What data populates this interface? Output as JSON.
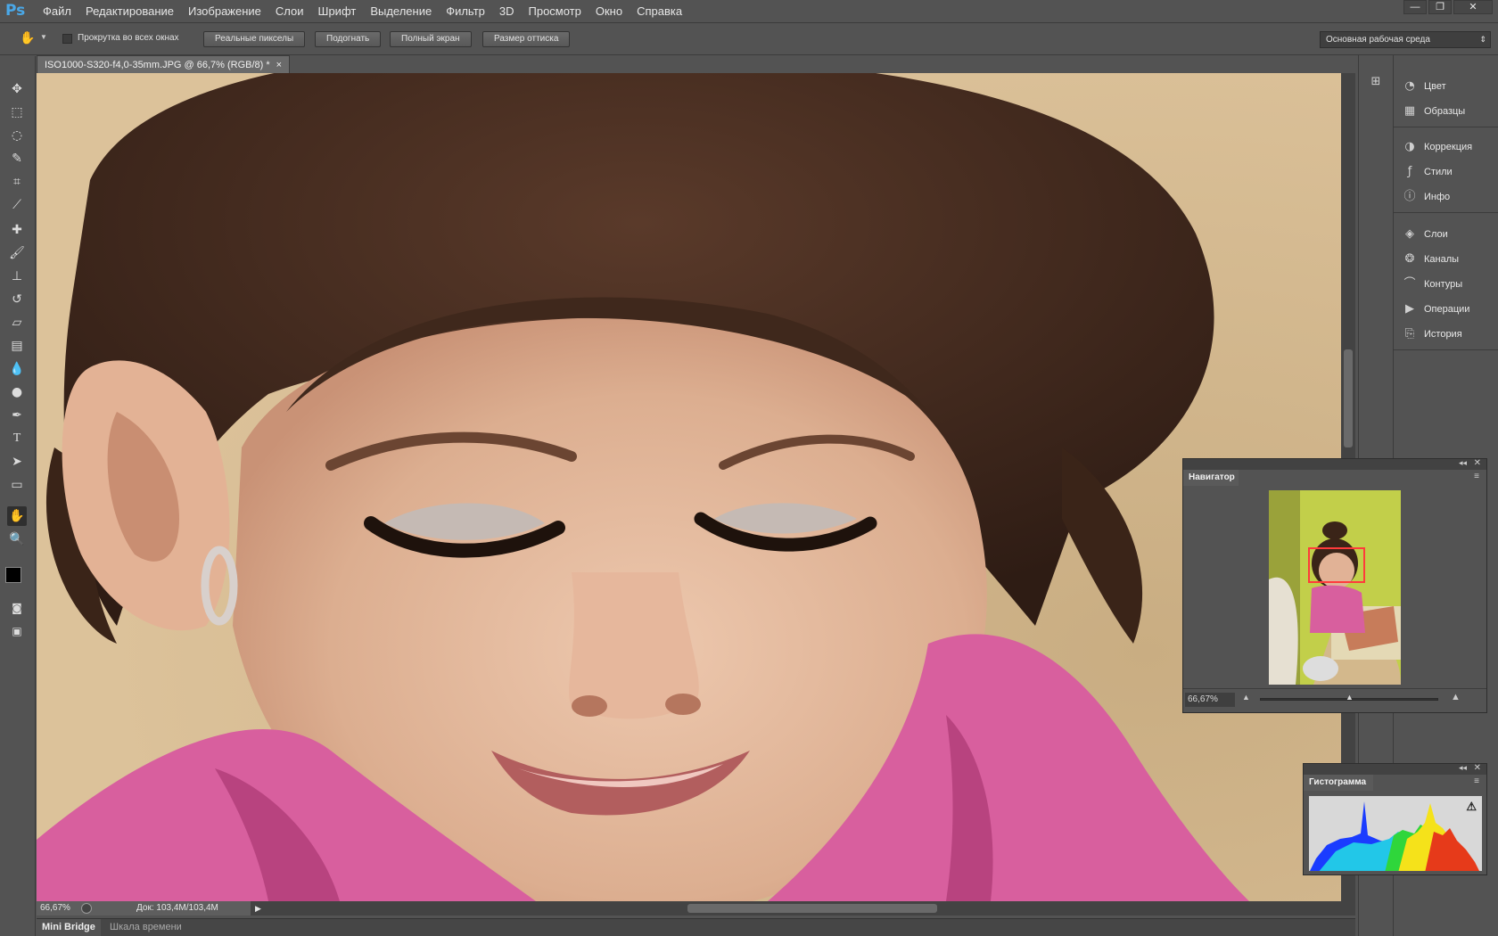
{
  "app": {
    "logo": "Ps"
  },
  "menu": [
    "Файл",
    "Редактирование",
    "Изображение",
    "Слои",
    "Шрифт",
    "Выделение",
    "Фильтр",
    "3D",
    "Просмотр",
    "Окно",
    "Справка"
  ],
  "options": {
    "scroll_all_label": "Прокрутка во всех окнах",
    "buttons": [
      "Реальные пикселы",
      "Подогнать",
      "Полный экран",
      "Размер оттиска"
    ],
    "workspace": "Основная рабочая среда"
  },
  "document": {
    "tab_title": "ISO1000-S320-f4,0-35mm.JPG @ 66,7% (RGB/8) *",
    "zoom": "66,67%",
    "doc_size": "Док: 103,4M/103,4M"
  },
  "bottom_tabs": [
    "Mini Bridge",
    "Шкала времени"
  ],
  "panels": [
    {
      "label": "Цвет",
      "icon": "color-icon"
    },
    {
      "label": "Образцы",
      "icon": "swatches-icon"
    },
    {
      "label": "Коррекция",
      "icon": "adjustments-icon"
    },
    {
      "label": "Стили",
      "icon": "styles-icon"
    },
    {
      "label": "Инфо",
      "icon": "info-icon"
    },
    {
      "label": "Слои",
      "icon": "layers-icon"
    },
    {
      "label": "Каналы",
      "icon": "channels-icon"
    },
    {
      "label": "Контуры",
      "icon": "paths-icon"
    },
    {
      "label": "Операции",
      "icon": "actions-icon"
    },
    {
      "label": "История",
      "icon": "history-icon"
    }
  ],
  "navigator": {
    "title": "Навигатор",
    "zoom": "66,67%"
  },
  "histogram": {
    "title": "Гистограмма"
  },
  "colors": {
    "accent": "#4aa8e8",
    "nav_frame": "#ff3b3b"
  }
}
